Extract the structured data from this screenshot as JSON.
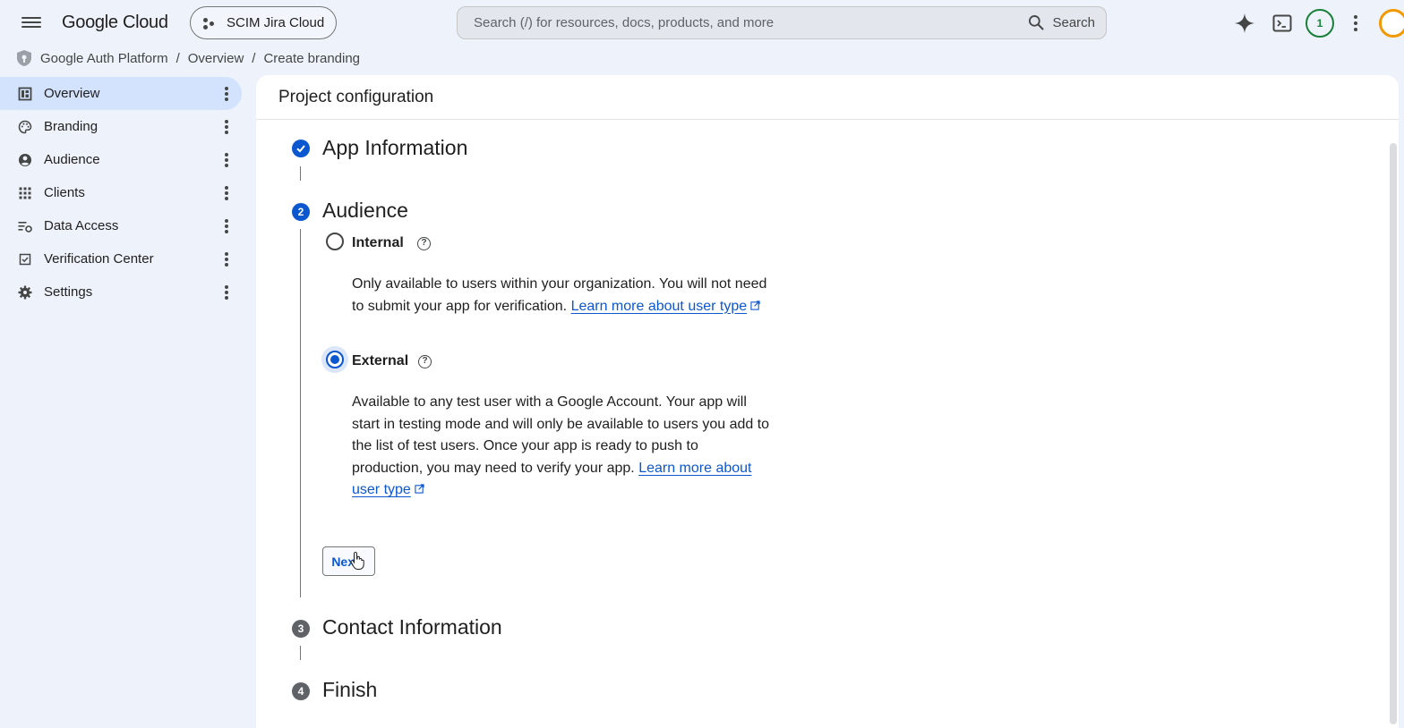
{
  "topbar": {
    "logo": "Google Cloud",
    "project_name": "SCIM Jira Cloud",
    "search_placeholder": "Search (/) for resources, docs, products, and more",
    "search_label": "Search",
    "notification_count": "1"
  },
  "breadcrumb": {
    "items": [
      "Google Auth Platform",
      "Overview",
      "Create branding"
    ]
  },
  "sidebar": {
    "items": [
      {
        "label": "Overview",
        "icon": "dashboard-icon"
      },
      {
        "label": "Branding",
        "icon": "palette-icon"
      },
      {
        "label": "Audience",
        "icon": "person-circle-icon"
      },
      {
        "label": "Clients",
        "icon": "apps-grid-icon"
      },
      {
        "label": "Data Access",
        "icon": "data-settings-icon"
      },
      {
        "label": "Verification Center",
        "icon": "checklist-icon"
      },
      {
        "label": "Settings",
        "icon": "gear-icon"
      }
    ],
    "active_index": 0
  },
  "main": {
    "header": "Project configuration",
    "steps": [
      {
        "number": "",
        "title": "App Information",
        "state": "done"
      },
      {
        "number": "2",
        "title": "Audience",
        "state": "current"
      },
      {
        "number": "3",
        "title": "Contact Information",
        "state": "pending"
      },
      {
        "number": "4",
        "title": "Finish",
        "state": "pending"
      }
    ],
    "options": {
      "internal": {
        "label": "Internal",
        "desc_before": "Only available to users within your organization. You will not need to submit your app for verification. ",
        "link": "Learn more about user type",
        "selected": false
      },
      "external": {
        "label": "External",
        "desc_before": "Available to any test user with a Google Account. Your app will start in testing mode and will only be available to users you add to the list of test users. Once your app is ready to push to production, you may need to verify your app. ",
        "link": "Learn more about user type",
        "selected": true
      }
    },
    "next_button": "Next"
  },
  "colors": {
    "accent": "#0b57d0",
    "nav_active": "#d3e3fd",
    "page_bg": "#eef2fa"
  }
}
